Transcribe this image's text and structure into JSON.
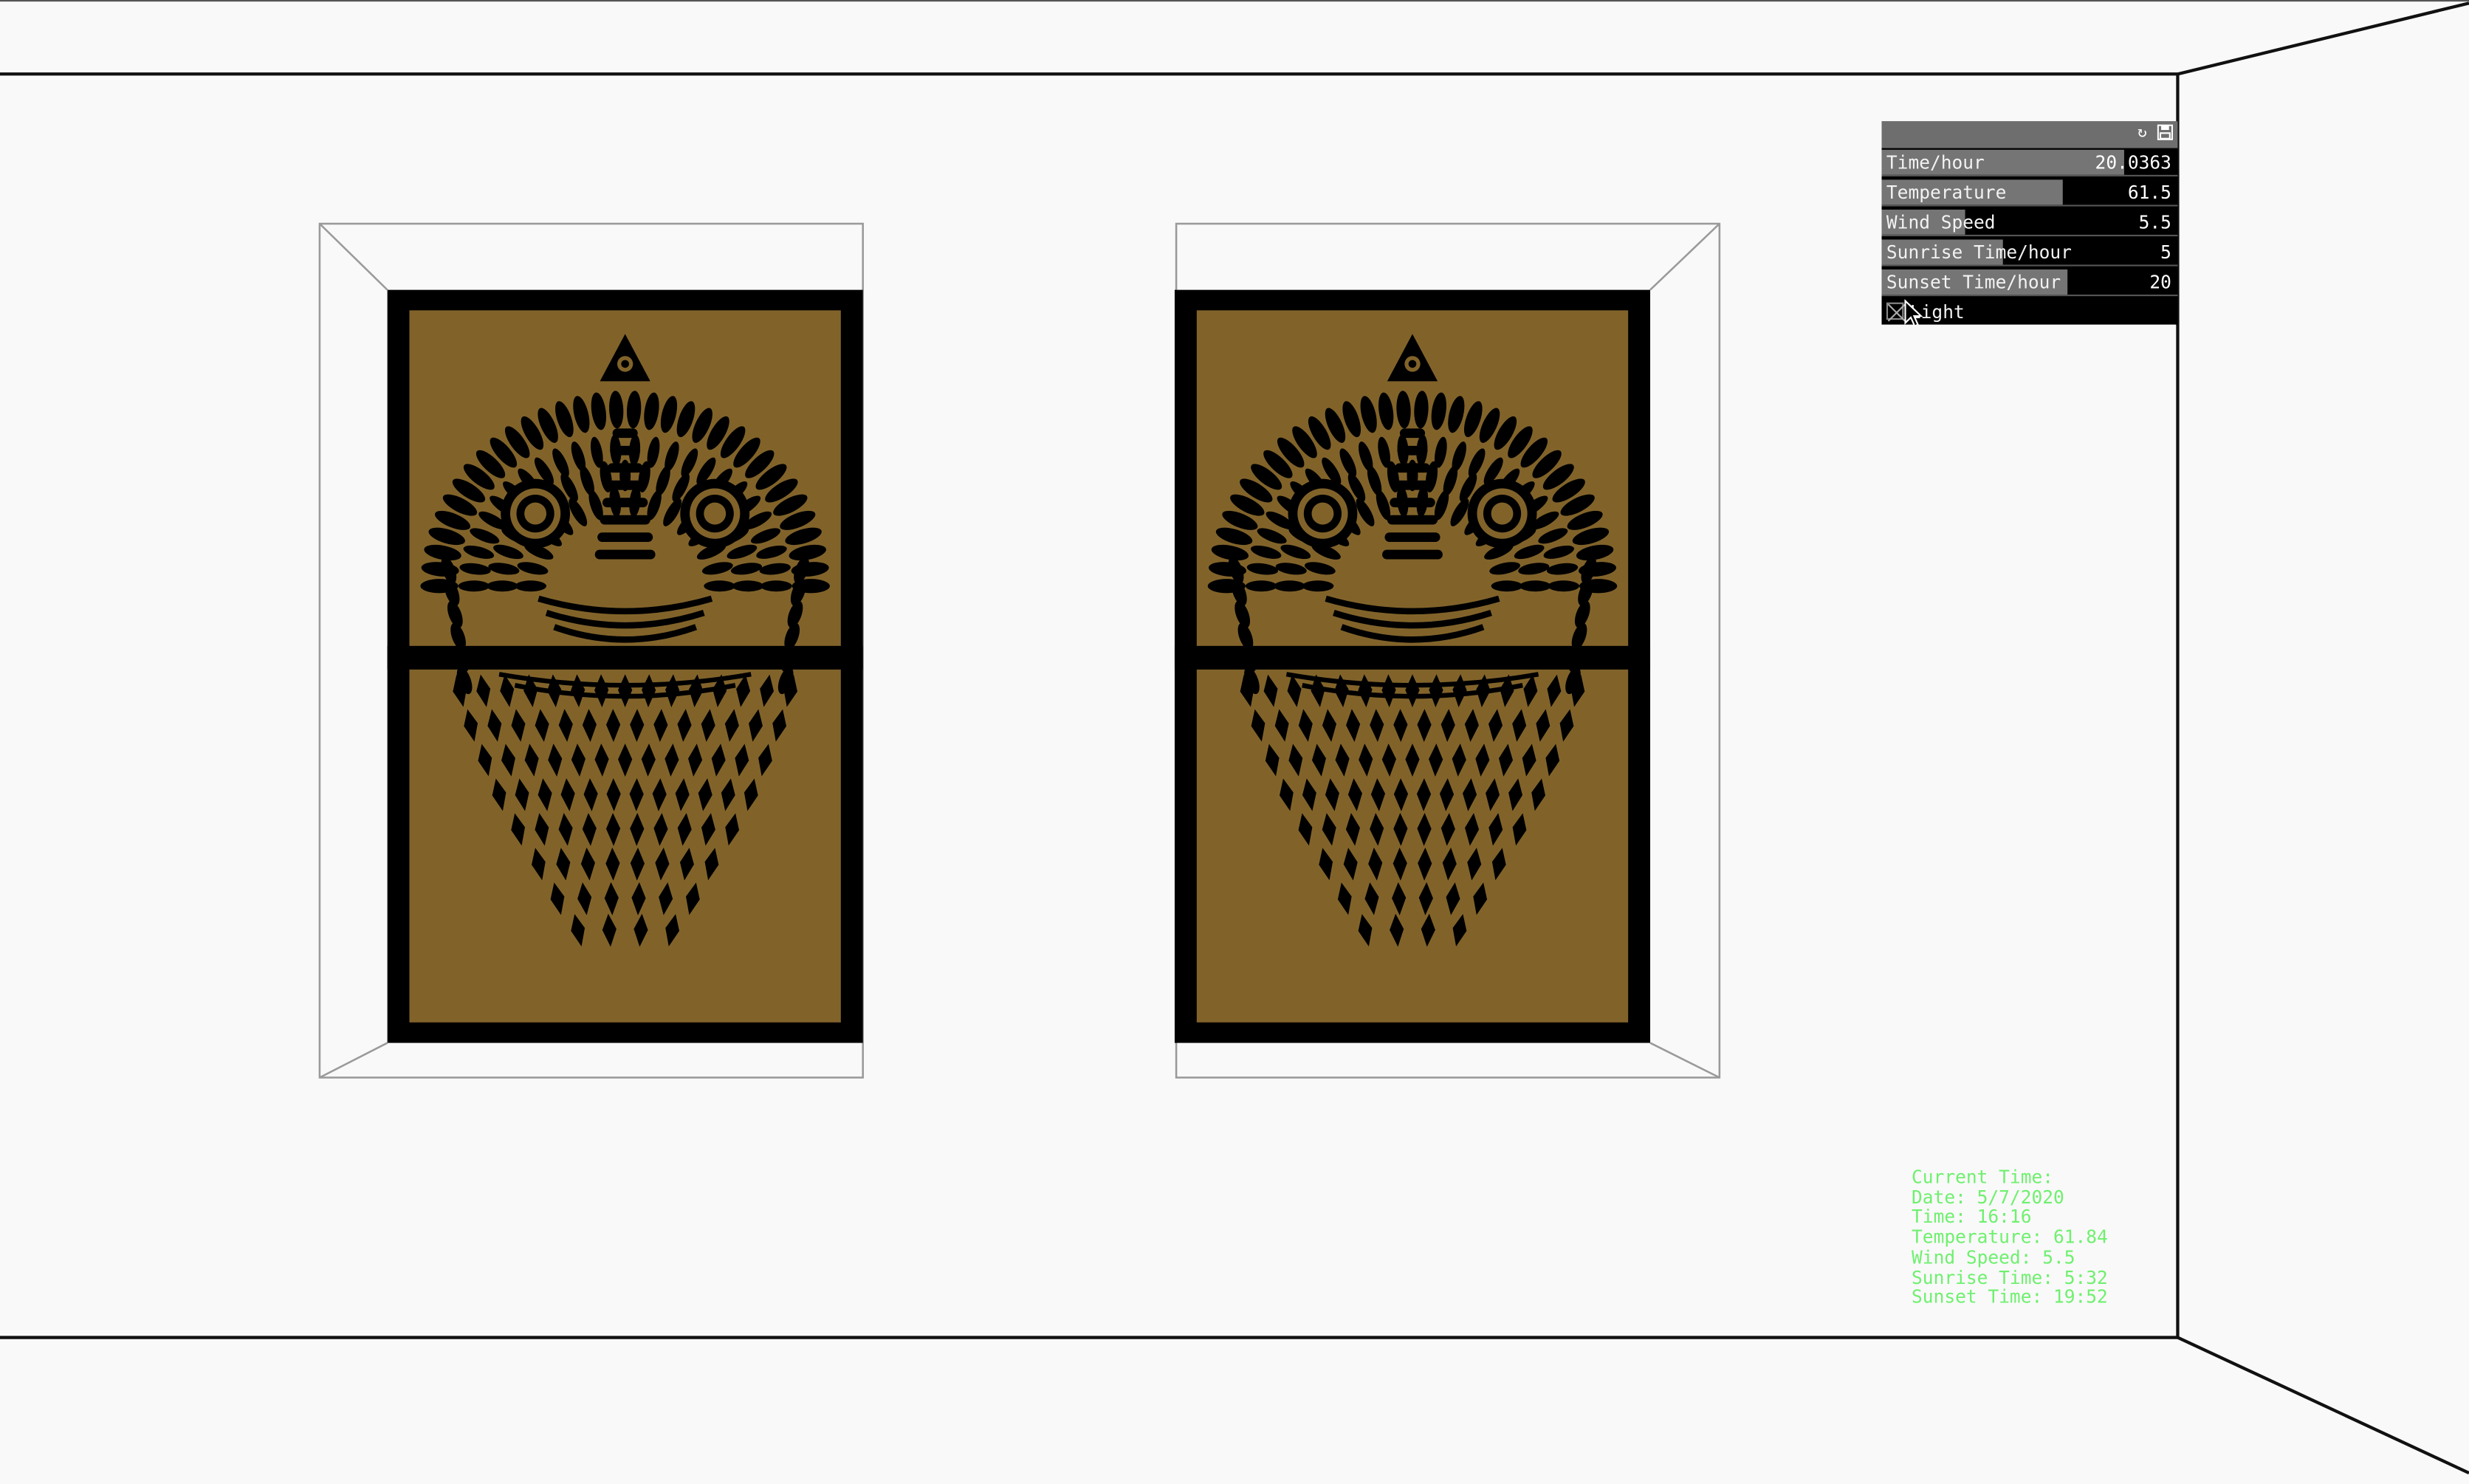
{
  "gui": {
    "controls": [
      {
        "label": "Time/hour",
        "value": "20.0363",
        "fraction": 0.82
      },
      {
        "label": "Temperature",
        "value": "61.5",
        "fraction": 0.61
      },
      {
        "label": "Wind Speed",
        "value": "5.5",
        "fraction": 0.28
      },
      {
        "label": "Sunrise Time/hour",
        "value": "5",
        "fraction": 0.41
      },
      {
        "label": "Sunset Time/hour",
        "value": "20",
        "fraction": 0.63
      }
    ],
    "checkbox": {
      "label": "Light",
      "checked": false
    },
    "header_icons": [
      "refresh-icon",
      "save-icon"
    ]
  },
  "readout": {
    "heading": "Current Time:",
    "date": "Date: 5/7/2020",
    "time": "Time: 16:16",
    "temperature": "Temperature: 61.84",
    "wind_speed": "Wind Speed: 5.5",
    "sunrise": "Sunrise Time: 5:32",
    "sunset": "Sunset Time: 19:52"
  },
  "colors": {
    "background": "#f9f9f9",
    "pane": "#81632a",
    "frame": "#000000",
    "readout_text": "#6ff06f",
    "gui_fill": "#757575"
  }
}
